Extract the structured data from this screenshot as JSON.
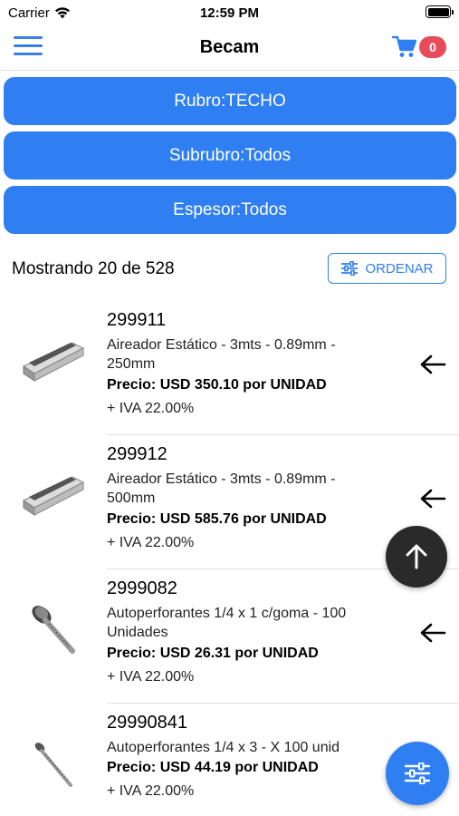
{
  "status_bar": {
    "carrier": "Carrier",
    "time": "12:59 PM"
  },
  "nav": {
    "title": "Becam",
    "cart_count": "0",
    "icons": {
      "menu": "hamburger-icon",
      "cart": "cart-icon"
    }
  },
  "filters": {
    "rubro": "Rubro:TECHO",
    "subrubro": "Subrubro:Todos",
    "espesor": "Espesor:Todos"
  },
  "list_header": {
    "count_text": "Mostrando 20 de 528",
    "order_label": "ORDENAR"
  },
  "products": [
    {
      "code": "299911",
      "description": "Aireador Estático - 3mts - 0.89mm - 250mm",
      "price": "Precio: USD 350.10 por UNIDAD",
      "iva": "+ IVA 22.00%",
      "image": "aireador-image"
    },
    {
      "code": "299912",
      "description": "Aireador Estático - 3mts - 0.89mm - 500mm",
      "price": "Precio: USD 585.76 por UNIDAD",
      "iva": "+ IVA 22.00%",
      "image": "aireador-image"
    },
    {
      "code": "2999082",
      "description": "Autoperforantes 1/4 x 1 c/goma - 100 Unidades",
      "price": "Precio: USD 26.31 por UNIDAD",
      "iva": "+ IVA 22.00%",
      "image": "screw-image"
    },
    {
      "code": "29990841",
      "description": "Autoperforantes 1/4 x 3 - X 100 unid",
      "price": "Precio: USD 44.19 por UNIDAD",
      "iva": "+ IVA 22.00%",
      "image": "screw-image"
    }
  ],
  "colors": {
    "accent": "#2f7ff2",
    "badge": "#e74c5c",
    "fab_dark": "#2a2a2a"
  }
}
